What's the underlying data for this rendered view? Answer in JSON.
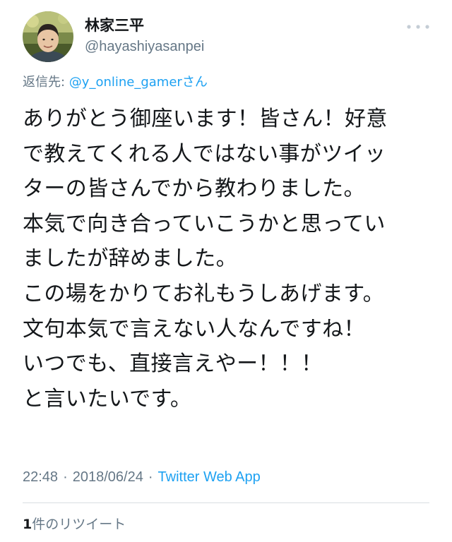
{
  "author": {
    "display_name": "林家三平",
    "handle": "@hayashiyasanpei",
    "avatar_icon": "profile-photo"
  },
  "more_icon": "more-horizontal-icon",
  "reply": {
    "prefix": "返信先: ",
    "mention": "@y_online_gamerさん"
  },
  "tweet": {
    "lines": [
      "ありがとう御座います！皆さん！好意",
      "で教えてくれる人ではない事がツイッ",
      "ターの皆さんでから教わりました。",
      "本気で向き合っていこうかと思ってい",
      "ましたが辞めました。",
      "この場をかりてお礼もうしあげます。",
      "文句本気で言えない人なんですね！",
      "いつでも、直接言えやー！！！",
      "と言いたいです。"
    ]
  },
  "meta": {
    "time": "22:48",
    "separator": "·",
    "date": "2018/06/24",
    "source": "Twitter Web App"
  },
  "stats": {
    "retweet_count": "1",
    "retweet_label": "件のリツイート"
  },
  "colors": {
    "link": "#1da1f2",
    "secondary_text": "#657786",
    "primary_text": "#14171a",
    "divider": "#d9dee2"
  }
}
